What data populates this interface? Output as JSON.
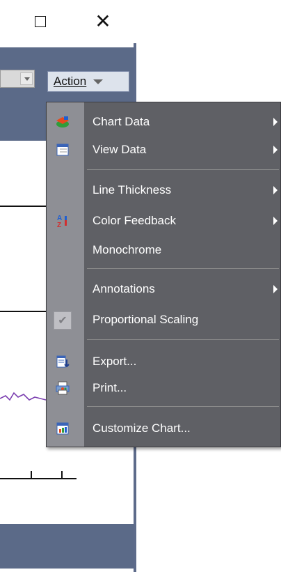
{
  "window": {
    "maximize_icon": "maximize-icon",
    "close_icon": "close-icon",
    "close_glyph": "✕"
  },
  "toolbar": {
    "action_label": "Action"
  },
  "menu": {
    "items": [
      {
        "label": "Chart Data",
        "icon": "chart-data-icon",
        "has_submenu": true
      },
      {
        "label": "View Data",
        "icon": "view-data-icon",
        "has_submenu": true
      },
      {
        "label": "Line Thickness",
        "icon": "",
        "has_submenu": true
      },
      {
        "label": "Color Feedback",
        "icon": "color-feedback-icon",
        "has_submenu": true
      },
      {
        "label": "Monochrome",
        "icon": "",
        "has_submenu": false
      },
      {
        "label": "Annotations",
        "icon": "",
        "has_submenu": true
      },
      {
        "label": "Proportional Scaling",
        "icon": "check-icon",
        "checked": true,
        "has_submenu": false
      },
      {
        "label": "Export...",
        "icon": "export-icon",
        "has_submenu": false
      },
      {
        "label": "Print...",
        "icon": "print-icon",
        "has_submenu": false
      },
      {
        "label": "Customize Chart...",
        "icon": "customize-chart-icon",
        "has_submenu": false
      }
    ]
  },
  "colors": {
    "frame": "#5b6a88",
    "menu_bg": "#5f6065",
    "menu_gutter": "#8e8f95",
    "menu_text": "#ffffff",
    "chart_line": "#7b3fb0"
  }
}
